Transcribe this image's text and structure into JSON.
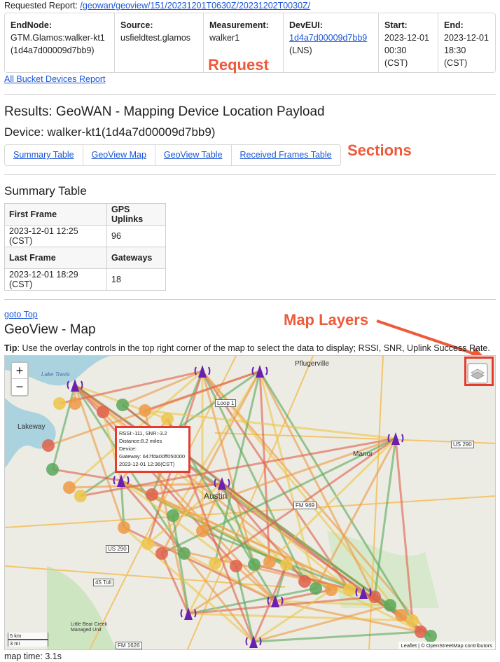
{
  "header": {
    "requested_label": "Requested Report:",
    "requested_link": "/geowan/geoview/151/20231201T0630Z/20231202T0030Z/"
  },
  "request": {
    "endnode_label": "EndNode:",
    "endnode_value": "GTM.Glamos:walker-kt1(1d4a7d00009d7bb9)",
    "source_label": "Source:",
    "source_value": "usfieldtest.glamos",
    "measurement_label": "Measurement:",
    "measurement_value": "walker1",
    "deveui_label": "DevEUI:",
    "deveui_value": "1d4a7d00009d7bb9",
    "deveui_suffix": "(LNS)",
    "start_label": "Start:",
    "start_value": "2023-12-01 00:30 (CST)",
    "end_label": "End:",
    "end_value": "2023-12-01 18:30 (CST)"
  },
  "annotations": {
    "request": "Request",
    "sections": "Sections",
    "map_layers": "Map Layers"
  },
  "links": {
    "bucket": "All Bucket Devices Report",
    "goto_top": "goto Top"
  },
  "results": {
    "title": "Results: GeoWAN - Mapping Device Location Payload",
    "device": "Device: walker-kt1(1d4a7d00009d7bb9)"
  },
  "tabs": [
    "Summary Table",
    "GeoView Map",
    "GeoView Table",
    "Received Frames Table"
  ],
  "summary": {
    "title": "Summary Table",
    "first_frame_label": "First Frame",
    "first_frame_value": "2023-12-01 12:25 (CST)",
    "gps_uplinks_label": "GPS Uplinks",
    "gps_uplinks_value": "96",
    "last_frame_label": "Last Frame",
    "last_frame_value": "2023-12-01 18:29 (CST)",
    "gateways_label": "Gateways",
    "gateways_value": "18"
  },
  "geoview": {
    "title": "GeoView - Map",
    "tip_label": "Tip",
    "tip_text": ": Use the overlay controls in the top right corner of the map to select the data to display; RSSI, SNR, Uplink Success Rate."
  },
  "map": {
    "zoom_in": "+",
    "zoom_out": "−",
    "popup": {
      "line1": "RSSI:-111, SNR:-3.2",
      "line2": "Distance:8.2 miles",
      "line3": "Device:",
      "line4": "Gateway: 647fda00ff050000",
      "line5": "2023-12-01 12:36(CST)"
    },
    "scale_km": "5 km",
    "scale_mi": "3 mi",
    "attribution": "Leaflet | © OpenStreetMap contributors",
    "places": [
      "Pflugerville",
      "Lakeway",
      "Manor",
      "Austin",
      "Loop 1",
      "FM 969",
      "US 290",
      "US 290",
      "45 Toll",
      "FM 1626",
      "Lake Travis",
      "Little Bear Creek Managed Unit"
    ],
    "colors": {
      "green": "#5aa85a",
      "yellow": "#efc64a",
      "orange": "#ee9a45",
      "red": "#e0604a",
      "gateway": "#6a1fb0"
    }
  },
  "footer": {
    "map_time": "map time: 3.1s"
  }
}
